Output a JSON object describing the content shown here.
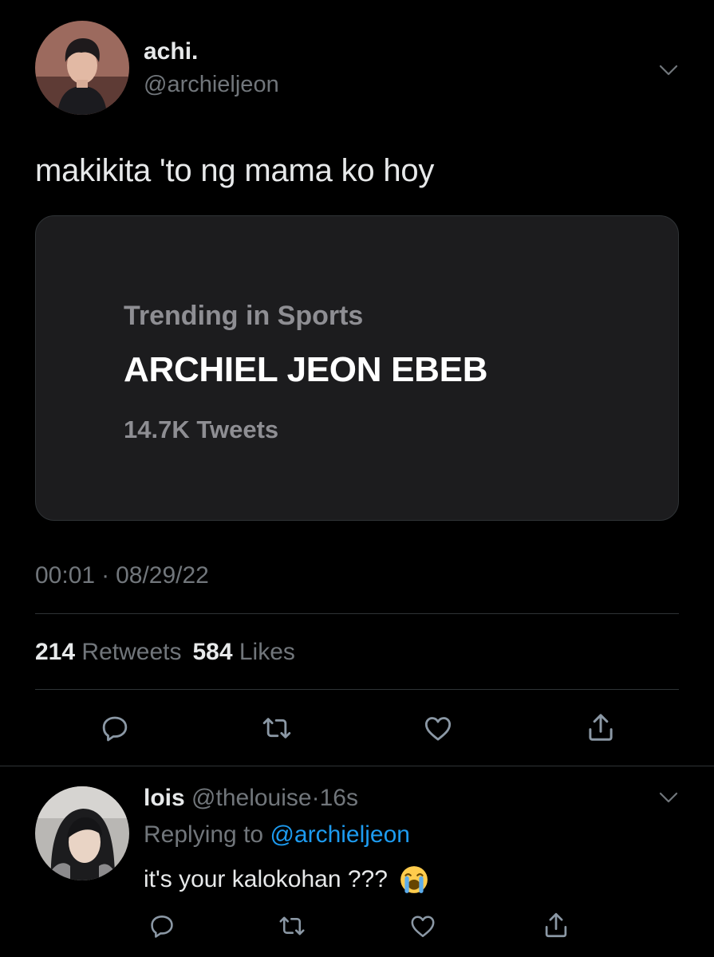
{
  "tweet": {
    "author": {
      "display_name": "achi.",
      "handle": "@archieljeon"
    },
    "text": "makikita 'to ng mama ko hoy",
    "card": {
      "category": "Trending in Sports",
      "title": "ARCHIEL JEON EBEB",
      "count": "14.7K Tweets"
    },
    "time": "00:01",
    "separator": "·",
    "date": "08/29/22",
    "stats": {
      "retweets_count": "214",
      "retweets_label": "Retweets",
      "likes_count": "584",
      "likes_label": "Likes"
    },
    "actions": [
      {
        "icon": "reply-icon"
      },
      {
        "icon": "retweet-icon"
      },
      {
        "icon": "like-icon"
      },
      {
        "icon": "share-icon"
      }
    ]
  },
  "reply": {
    "author": {
      "display_name": "lois",
      "handle": "@thelouise"
    },
    "separator": "·",
    "time_ago": "16s",
    "replying_prefix": "Replying to",
    "replying_to": "@archieljeon",
    "text": "it's your kalokohan ???",
    "emoji": "loudly-crying-face-emoji",
    "actions": [
      {
        "icon": "reply-icon"
      },
      {
        "icon": "retweet-icon"
      },
      {
        "icon": "like-icon"
      },
      {
        "icon": "share-icon"
      }
    ]
  },
  "colors": {
    "background": "#000000",
    "card": "#1c1c1e",
    "text": "#e7e9ea",
    "secondary": "#71767b",
    "link": "#1d9bf0"
  }
}
